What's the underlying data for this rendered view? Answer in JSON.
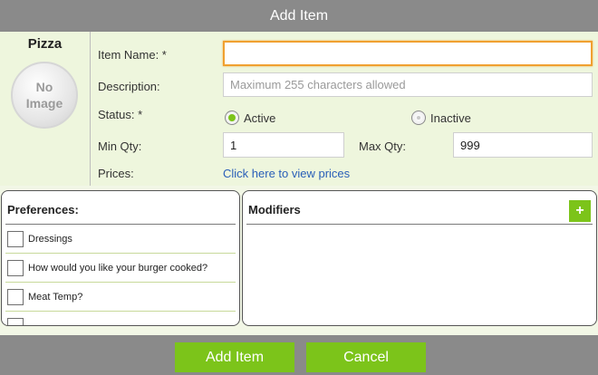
{
  "dialog": {
    "title": "Add Item"
  },
  "item": {
    "category_name": "Pizza",
    "no_image_text": "No\nImage"
  },
  "form": {
    "item_name": {
      "label": "Item Name: *",
      "value": ""
    },
    "description": {
      "label": "Description:",
      "placeholder": "Maximum 255 characters allowed"
    },
    "status": {
      "label": "Status: *",
      "options": [
        {
          "label": "Active",
          "selected": true
        },
        {
          "label": "Inactive",
          "selected": false
        }
      ]
    },
    "min_qty": {
      "label": "Min Qty:",
      "value": "1"
    },
    "max_qty": {
      "label": "Max Qty:",
      "value": "999"
    },
    "prices": {
      "label": "Prices:",
      "link_text": "Click here to view prices"
    }
  },
  "preferences": {
    "title": "Preferences:",
    "items": [
      {
        "label": "Dressings",
        "checked": false
      },
      {
        "label": "How would you like your burger cooked?",
        "checked": false
      },
      {
        "label": "Meat Temp?",
        "checked": false
      },
      {
        "label": "",
        "checked": false
      }
    ]
  },
  "modifiers": {
    "title": "Modifiers",
    "add_label": "+"
  },
  "actions": {
    "add_label": "Add Item",
    "cancel_label": "Cancel"
  },
  "colors": {
    "accent": "#7cc41a",
    "title_bar": "#8a8a8a",
    "form_bg": "#eef6dd",
    "focus": "#f0a030",
    "link": "#2a5fb8"
  }
}
